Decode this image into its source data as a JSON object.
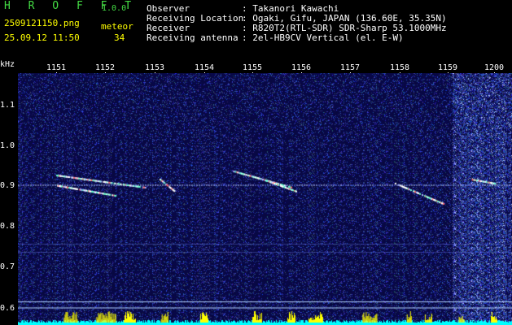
{
  "header": {
    "app_title": "H R O F F T",
    "version": "1.0.0",
    "filename": "2509121150.png",
    "timestamp": "25.09.12 11:50",
    "meteor_label": "meteor",
    "meteor_count": "34",
    "info": [
      {
        "key": "Observer",
        "value": ": Takanori Kawachi"
      },
      {
        "key": "Receiving Location",
        "value": ": Ogaki, Gifu, JAPAN (136.60E, 35.35N)"
      },
      {
        "key": "Receiver",
        "value": ": R820T2(RTL-SDR) SDR-Sharp 53.1000MHz"
      },
      {
        "key": "Receiving antenna",
        "value": ": 2el-HB9CV Vertical (el. E-W)"
      }
    ]
  },
  "chart_data": {
    "type": "heatmap",
    "ylabel": "kHz",
    "x_ticks": [
      "1151",
      "1152",
      "1153",
      "1154",
      "1155",
      "1156",
      "1157",
      "1158",
      "1159",
      "1200"
    ],
    "y_ticks": [
      "1.1",
      "1.0",
      "0.9",
      "0.8",
      "0.7",
      "0.6"
    ],
    "carrier_khz": 0.905,
    "meteor_traces": [
      {
        "t_start": "1151",
        "t_end": "1152.8",
        "f_start": 0.93,
        "f_end": 0.9
      },
      {
        "t_start": "1151",
        "t_end": "1152.2",
        "f_start": 0.905,
        "f_end": 0.88
      },
      {
        "t_start": "1153.1",
        "t_end": "1153.4",
        "f_start": 0.92,
        "f_end": 0.89
      },
      {
        "t_start": "1154.6",
        "t_end": "1155.8",
        "f_start": 0.94,
        "f_end": 0.9
      },
      {
        "t_start": "1155.2",
        "t_end": "1155.9",
        "f_start": 0.92,
        "f_end": 0.89
      },
      {
        "t_start": "1157.9",
        "t_end": "1158.9",
        "f_start": 0.91,
        "f_end": 0.86
      },
      {
        "t_start": "1159.5",
        "t_end": "1200",
        "f_start": 0.92,
        "f_end": 0.91
      }
    ],
    "colors": {
      "background": "#0a0a4a",
      "noise": "#3344cc",
      "signal": "#ffffff",
      "level": "#ffff00",
      "baseline": "#00ffff"
    }
  }
}
